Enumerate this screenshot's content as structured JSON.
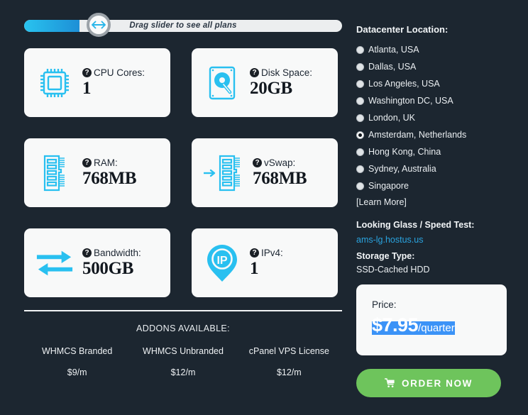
{
  "slider": {
    "label": "Drag slider to see all plans",
    "fill_percent": 17,
    "handle_percent": 20,
    "track_color": "#eceeef",
    "fill_color_start": "#29c3ef",
    "fill_color_end": "#1d8fd6",
    "handle_icon": "left-right-arrow-icon"
  },
  "specs": [
    {
      "icon": "cpu-chip-icon",
      "label": "CPU Cores:",
      "value": "1",
      "help": "?"
    },
    {
      "icon": "hard-disk-icon",
      "label": "Disk Space:",
      "value": "20GB",
      "help": "?"
    },
    {
      "icon": "ram-stick-icon",
      "label": "RAM:",
      "value": "768MB",
      "help": "?"
    },
    {
      "icon": "vswap-arrow-ram-icon",
      "label": "vSwap:",
      "value": "768MB",
      "help": "?"
    },
    {
      "icon": "bandwidth-arrows-icon",
      "label": "Bandwidth:",
      "value": "500GB",
      "help": "?"
    },
    {
      "icon": "ip-location-pin-icon",
      "label": "IPv4:",
      "value": "1",
      "help": "?"
    }
  ],
  "addons": {
    "title": "ADDONS AVAILABLE:",
    "items": [
      {
        "name": "WHMCS Branded",
        "price": "$9/m"
      },
      {
        "name": "WHMCS Unbranded",
        "price": "$12/m"
      },
      {
        "name": "cPanel VPS License",
        "price": "$12/m"
      }
    ]
  },
  "datacenter": {
    "title": "Datacenter Location:",
    "selected": "Amsterdam, Netherlands",
    "options": [
      {
        "label": "Atlanta, USA",
        "checked": false
      },
      {
        "label": "Dallas, USA",
        "checked": false
      },
      {
        "label": "Los Angeles, USA",
        "checked": false
      },
      {
        "label": "Washington DC, USA",
        "checked": false
      },
      {
        "label": "London, UK",
        "checked": false
      },
      {
        "label": "Amsterdam, Netherlands",
        "checked": true
      },
      {
        "label": "Hong Kong, China",
        "checked": false
      },
      {
        "label": "Sydney, Australia",
        "checked": false
      },
      {
        "label": "Singapore",
        "checked": false
      }
    ],
    "learn_more": "[Learn More]"
  },
  "looking_glass": {
    "title": "Looking Glass / Speed Test:",
    "link": "ams-lg.hostus.us",
    "link_color": "#2aa4e0"
  },
  "storage": {
    "title": "Storage Type:",
    "value": "SSD-Cached HDD"
  },
  "price": {
    "label": "Price:",
    "amount": "$7.95",
    "period": "/quarter",
    "selection_color": "#3b93f7"
  },
  "order": {
    "label": "ORDER NOW",
    "icon": "shopping-cart-icon",
    "color": "#6ec45c"
  },
  "theme": {
    "background": "#1c2630",
    "card_background": "#f8f9f9",
    "accent_cyan": "#29c0f0",
    "text_light": "#eaeef1",
    "text_dark": "#12181f"
  }
}
